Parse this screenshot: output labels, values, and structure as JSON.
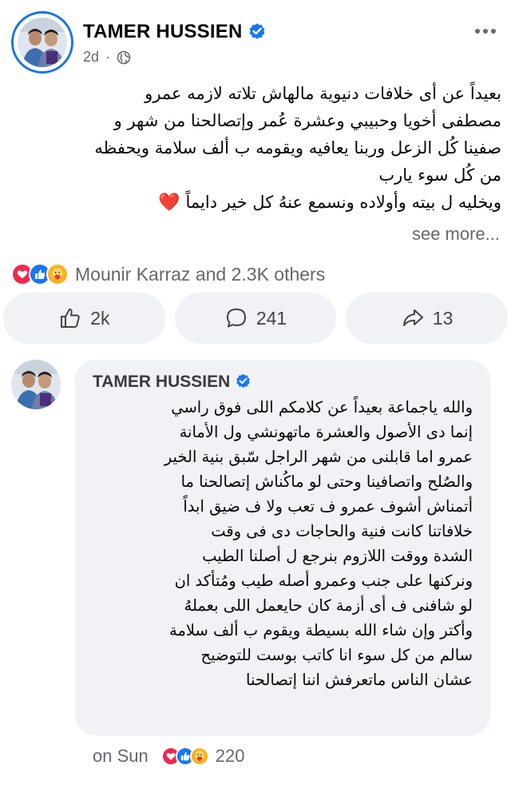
{
  "post": {
    "author": "TAMER HUSSIEN",
    "time": "2d",
    "privacy_icon": "globe-icon",
    "more_icon": "more-horizontal-icon",
    "text_lines": [
      "بعيداً عن أى خلافات دنيوية مالهاش تلاته لازمه  عمرو",
      "مصطفى أخويا وحبيبي وعشرة عُمر وإتصالحنا من شهر و",
      "صفينا كُل الزعل وربنا يعافيه ويقومه ب ألف سلامة ويحفظه",
      "من كُل سوء يارب",
      "ويخليه ل بيته وأولاده   ونسمع عنهُ كل خير دايماً"
    ],
    "heart_emoji": "❤️",
    "see_more": "see more...",
    "reactions_text": "Mounir Karraz and 2.3K others",
    "reaction_icons": [
      "love-icon",
      "like-icon",
      "care-icon"
    ],
    "actions": {
      "like_count": "2k",
      "comment_count": "241",
      "share_count": "13"
    }
  },
  "comment": {
    "author": "TAMER HUSSIEN",
    "text_lines": [
      "والله ياجماعة  بعيداً عن كلامكم اللى فوق راسي",
      "إنما دى الأصول والعشرة ماتهونشي ول الأمانة",
      "عمرو اما قابلنى من شهر الراجل سّبق بنية الخير",
      "والصُلح واتصافينا وحتى لو ماكُناش إتصالحنا ما",
      "أتمناش أشوف عمرو ف تعب ولا ف ضيق ابداً",
      "خلافاتنا كانت فنية والحاجات دى فى وقت",
      "الشدة ووقت اللازوم بنرجع ل أصلنا الطيب",
      "ونركنها على جنب وعمرو أصله طيب ومُتأكد ان",
      "لو شافنى ف أى أزمة كان حايعمل اللى بعملهُ",
      "وأكتر وإن شاء الله بسيطة ويقوم ب ألف سلامة",
      "سالم من كل سوء انا كاتب بوست للتوضيح",
      "عشان الناس ماتعرفش اننا إتصالحنا"
    ],
    "time": "on Sun",
    "reaction_count": "220"
  },
  "colors": {
    "verified_blue": "#1877f2",
    "avatar_ring": "#1b74e4",
    "love": "#f0284a",
    "like": "#1877f2",
    "care": "#f7b125",
    "bubble_bg": "#f0f2f5",
    "secondary_text": "#65676b"
  }
}
